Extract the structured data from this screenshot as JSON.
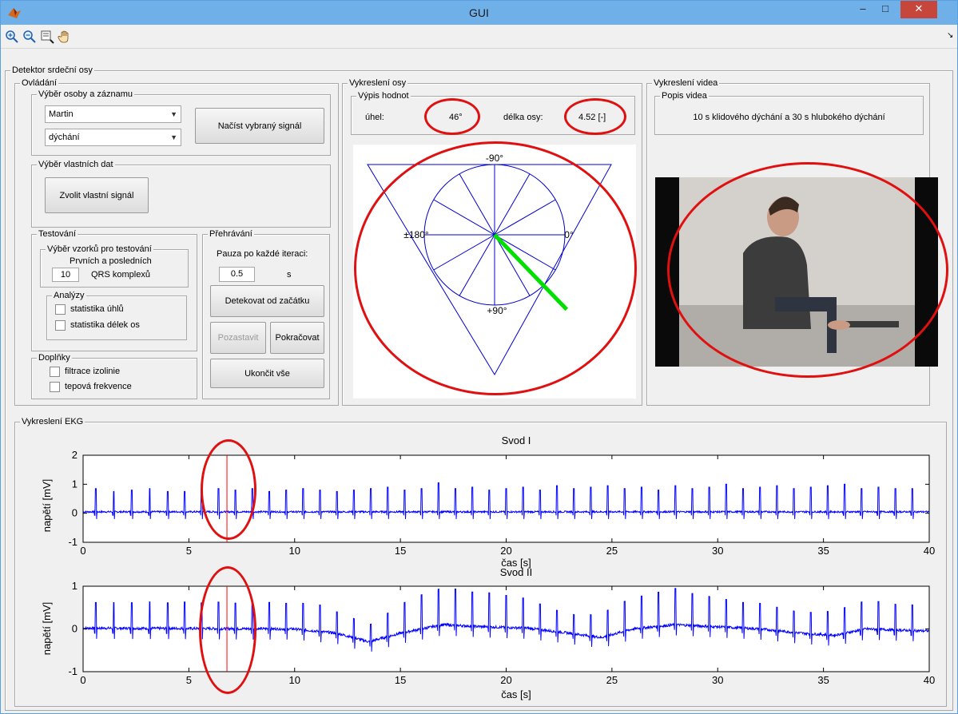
{
  "window": {
    "title": "GUI",
    "minimize_glyph": "–",
    "maximize_glyph": "□",
    "close_glyph": "✕",
    "app_icon": "matlab-icon"
  },
  "toolbar": {
    "icons": [
      "zoom-in-icon",
      "zoom-out-icon",
      "data-cursor-icon",
      "pan-hand-icon"
    ],
    "overflow_glyph": "↘"
  },
  "main_panel": {
    "title": "Detektor srdeční osy"
  },
  "controls": {
    "title": "Ovládání",
    "selection": {
      "title": "Výběr osoby a záznamu",
      "person_value": "Martin",
      "record_value": "dýchání",
      "load_button": "Načíst vybraný signál"
    },
    "own_data": {
      "title": "Výběr vlastních dat",
      "choose_button": "Zvolit vlastní signál"
    },
    "testing": {
      "title": "Testování",
      "samples": {
        "title": "Výběr vzorků pro testování",
        "line1": "Prvních a posledních",
        "count_value": "10",
        "line2": "QRS komplexů"
      },
      "analysis": {
        "title": "Analýzy",
        "angle_stats": "statistika úhlů",
        "length_stats": "statistika délek os"
      }
    },
    "extras": {
      "title": "Doplňky",
      "isoline_filter": "filtrace izolinie",
      "heart_rate": "tepová frekvence"
    },
    "playback": {
      "title": "Přehrávání",
      "pause_label": "Pauza po každé iteraci:",
      "pause_value": "0.5",
      "pause_unit": "s",
      "detect_button": "Detekovat od začátku",
      "stop_button": "Pozastavit",
      "continue_button": "Pokračovat",
      "end_button": "Ukončit vše"
    }
  },
  "axis_panel": {
    "title": "Vykreslení osy",
    "values": {
      "title": "Výpis hodnot",
      "angle_label": "úhel:",
      "angle_value": "46°",
      "length_label": "délka osy:",
      "length_value": "4.52 [-]"
    },
    "hexaxial": {
      "top_label": "-90°",
      "left_label": "±180°",
      "right_label": "0°",
      "bottom_label": "+90°",
      "axis_angle_deg": 46,
      "axis_length": 4.52
    }
  },
  "video_panel": {
    "title": "Vykreslení videa",
    "description": {
      "title": "Popis videa",
      "text": "10 s klidového dýchání a 30 s hlubokého dýchání"
    }
  },
  "ekg_panel": {
    "title": "Vykreslení EKG"
  },
  "chart_data": [
    {
      "type": "line",
      "title": "Svod I",
      "xlabel": "čas [s]",
      "ylabel": "napětí [mV]",
      "xlim": [
        0,
        40
      ],
      "ylim": [
        -1,
        2
      ],
      "xticks": [
        0,
        5,
        10,
        15,
        20,
        25,
        30,
        35,
        40
      ],
      "yticks": [
        -1,
        0,
        1,
        2
      ],
      "cursor_x": 6.8,
      "series": [
        {
          "color": "#0000ff",
          "baseline": 0.05,
          "r_peak_times": [
            0.6,
            1.45,
            2.3,
            3.15,
            4.0,
            4.8,
            5.6,
            6.4,
            7.2,
            8.0,
            8.8,
            9.6,
            10.4,
            11.2,
            12.0,
            12.8,
            13.6,
            14.4,
            15.2,
            16.0,
            16.8,
            17.6,
            18.4,
            19.2,
            20.0,
            20.8,
            21.6,
            22.4,
            23.2,
            24.0,
            24.8,
            25.6,
            26.4,
            27.2,
            28.0,
            28.8,
            29.6,
            30.4,
            31.2,
            32.0,
            32.8,
            33.6,
            34.4,
            35.2,
            36.0,
            36.8,
            37.6,
            38.4,
            39.2
          ],
          "r_peak_values": [
            0.8,
            0.7,
            0.75,
            0.8,
            0.7,
            0.7,
            0.75,
            0.8,
            0.75,
            0.8,
            0.7,
            0.75,
            0.8,
            0.75,
            0.7,
            0.75,
            0.8,
            0.85,
            0.75,
            0.8,
            1.0,
            0.8,
            0.85,
            0.75,
            0.8,
            0.85,
            0.75,
            0.9,
            0.8,
            0.85,
            0.9,
            0.8,
            0.85,
            0.75,
            0.9,
            0.8,
            0.85,
            0.95,
            0.8,
            0.85,
            0.9,
            0.8,
            0.85,
            0.9,
            0.95,
            0.8,
            0.85,
            0.8,
            0.8
          ]
        }
      ]
    },
    {
      "type": "line",
      "title": "Svod II",
      "xlabel": "čas [s]",
      "ylabel": "napětí [mV]",
      "xlim": [
        0,
        40
      ],
      "ylim": [
        -1,
        1
      ],
      "xticks": [
        0,
        5,
        10,
        15,
        20,
        25,
        30,
        35,
        40
      ],
      "yticks": [
        -1,
        0,
        1
      ],
      "cursor_x": 6.8,
      "series": [
        {
          "color": "#0000ff",
          "baseline_points": [
            [
              0,
              0.02
            ],
            [
              10,
              0.0
            ],
            [
              12,
              -0.1
            ],
            [
              13.5,
              -0.3
            ],
            [
              15,
              -0.1
            ],
            [
              17,
              0.1
            ],
            [
              19,
              0.05
            ],
            [
              21,
              0.02
            ],
            [
              23,
              -0.1
            ],
            [
              24.5,
              -0.2
            ],
            [
              26,
              0.0
            ],
            [
              28,
              0.1
            ],
            [
              30,
              0.05
            ],
            [
              32,
              0.0
            ],
            [
              34,
              -0.1
            ],
            [
              35.5,
              -0.15
            ],
            [
              37,
              0.0
            ],
            [
              40,
              -0.05
            ]
          ],
          "r_peak_times": [
            0.6,
            1.45,
            2.3,
            3.15,
            4.0,
            4.8,
            5.6,
            6.4,
            7.2,
            8.0,
            8.8,
            9.6,
            10.4,
            11.2,
            12.0,
            12.8,
            13.6,
            14.4,
            15.2,
            16.0,
            16.8,
            17.6,
            18.4,
            19.2,
            20.0,
            20.8,
            21.6,
            22.4,
            23.2,
            24.0,
            24.8,
            25.6,
            26.4,
            27.2,
            28.0,
            28.8,
            29.6,
            30.4,
            31.2,
            32.0,
            32.8,
            33.6,
            34.4,
            35.2,
            36.0,
            36.8,
            37.6,
            38.4,
            39.2
          ],
          "r_peak_values": [
            0.6,
            0.6,
            0.6,
            0.62,
            0.6,
            0.62,
            0.6,
            0.62,
            0.6,
            0.6,
            0.62,
            0.6,
            0.62,
            0.62,
            0.5,
            0.45,
            0.4,
            0.55,
            0.7,
            0.8,
            0.85,
            0.85,
            0.8,
            0.8,
            0.75,
            0.7,
            0.6,
            0.5,
            0.45,
            0.5,
            0.6,
            0.7,
            0.75,
            0.8,
            0.85,
            0.75,
            0.7,
            0.65,
            0.6,
            0.6,
            0.55,
            0.5,
            0.5,
            0.55,
            0.6,
            0.65,
            0.65,
            0.6,
            0.6
          ]
        }
      ]
    }
  ],
  "annotation_color": "#e01010"
}
